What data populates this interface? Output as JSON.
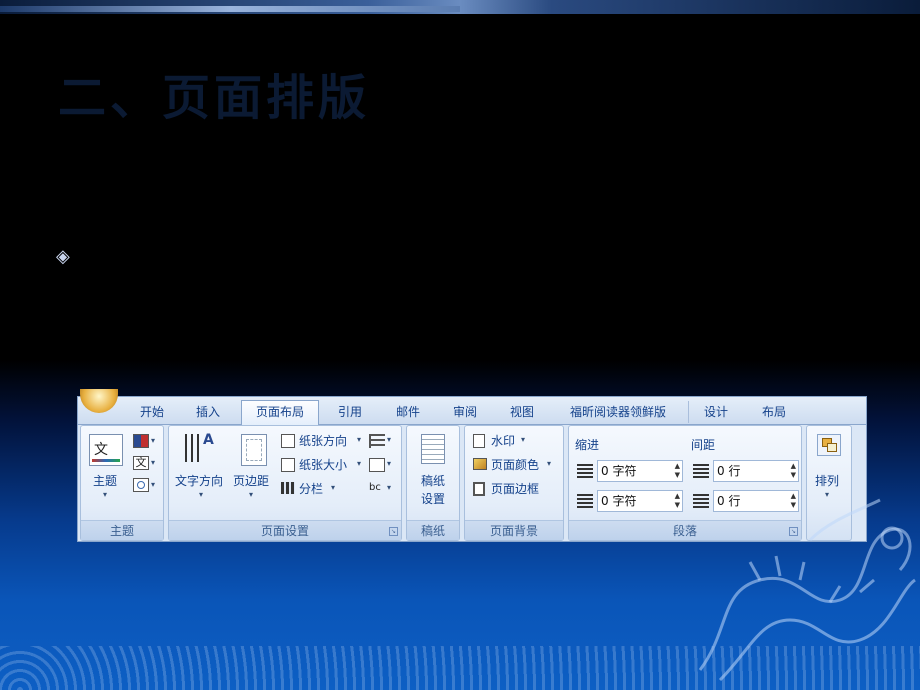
{
  "slide": {
    "title": "二、页面排版",
    "bullet_symbol": "◈"
  },
  "ribbon": {
    "tabs": [
      {
        "label": "开始"
      },
      {
        "label": "插入"
      },
      {
        "label": "页面布局",
        "active": true
      },
      {
        "label": "引用"
      },
      {
        "label": "邮件"
      },
      {
        "label": "审阅"
      },
      {
        "label": "视图"
      },
      {
        "label": "福昕阅读器领鲜版"
      },
      {
        "label": "设计"
      },
      {
        "label": "布局"
      }
    ],
    "groups": {
      "theme": {
        "label": "主题",
        "theme_button": "主题",
        "theme_icon_glyph": "文"
      },
      "page_setup": {
        "label": "页面设置",
        "text_direction": "文字方向",
        "margins": "页边距",
        "orientation": "纸张方向",
        "size": "纸张大小",
        "columns": "分栏"
      },
      "draft": {
        "label": "稿纸",
        "button_line1": "稿纸",
        "button_line2": "设置"
      },
      "page_background": {
        "label": "页面背景",
        "watermark": "水印",
        "page_color": "页面颜色",
        "page_borders": "页面边框"
      },
      "paragraph": {
        "label": "段落",
        "indent_header": "缩进",
        "spacing_header": "间距",
        "indent_left": "0 字符",
        "indent_right": "0 字符",
        "spacing_before": "0 行",
        "spacing_after": "0 行"
      },
      "arrange": {
        "label": "排列"
      }
    }
  },
  "colors": {
    "ribbon_text": "#15428b",
    "ribbon_bg": "#dbe7f6",
    "slide_bg_top": "#000000",
    "slide_bg_bottom": "#0d5fc4"
  }
}
